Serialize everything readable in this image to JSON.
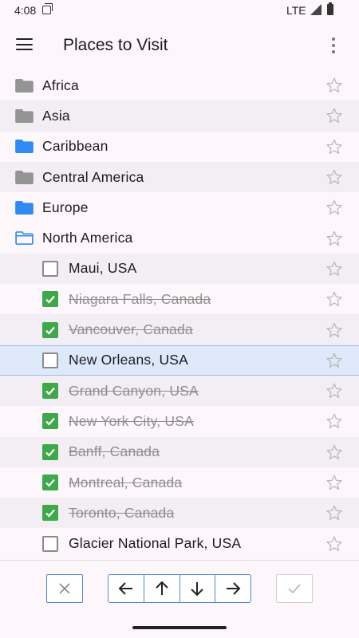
{
  "status_bar": {
    "time": "4:08",
    "network": "LTE"
  },
  "app_bar": {
    "title": "Places to Visit"
  },
  "colors": {
    "folder_gray": "#949494",
    "folder_blue": "#2f8bf3",
    "checkbox_green": "#3ea84a",
    "selected_row": "#dde9fb",
    "accent_border": "#4c86e0"
  },
  "folders": [
    {
      "label": "Africa",
      "icon": "folder-icon",
      "color": "gray"
    },
    {
      "label": "Asia",
      "icon": "folder-icon",
      "color": "gray"
    },
    {
      "label": "Caribbean",
      "icon": "folder-icon",
      "color": "blue"
    },
    {
      "label": "Central America",
      "icon": "folder-icon",
      "color": "gray"
    },
    {
      "label": "Europe",
      "icon": "folder-icon",
      "color": "blue"
    },
    {
      "label": "North America",
      "icon": "folder-open-icon",
      "color": "blue-outline"
    }
  ],
  "places": [
    {
      "label": "Maui, USA",
      "checked": false
    },
    {
      "label": "Niagara Falls, Canada",
      "checked": true
    },
    {
      "label": "Vancouver, Canada",
      "checked": true
    },
    {
      "label": "New Orleans, USA",
      "checked": false,
      "selected": true
    },
    {
      "label": "Grand Canyon, USA",
      "checked": true
    },
    {
      "label": "New York City, USA",
      "checked": true
    },
    {
      "label": "Banff, Canada",
      "checked": true
    },
    {
      "label": "Montreal, Canada",
      "checked": true
    },
    {
      "label": "Toronto, Canada",
      "checked": true
    },
    {
      "label": "Glacier National Park, USA",
      "checked": false
    }
  ],
  "toolbar": {
    "cancel_icon": "close-icon",
    "nav_icons": [
      "arrow-left-icon",
      "arrow-up-icon",
      "arrow-down-icon",
      "arrow-right-icon"
    ],
    "confirm_icon": "check-icon"
  }
}
